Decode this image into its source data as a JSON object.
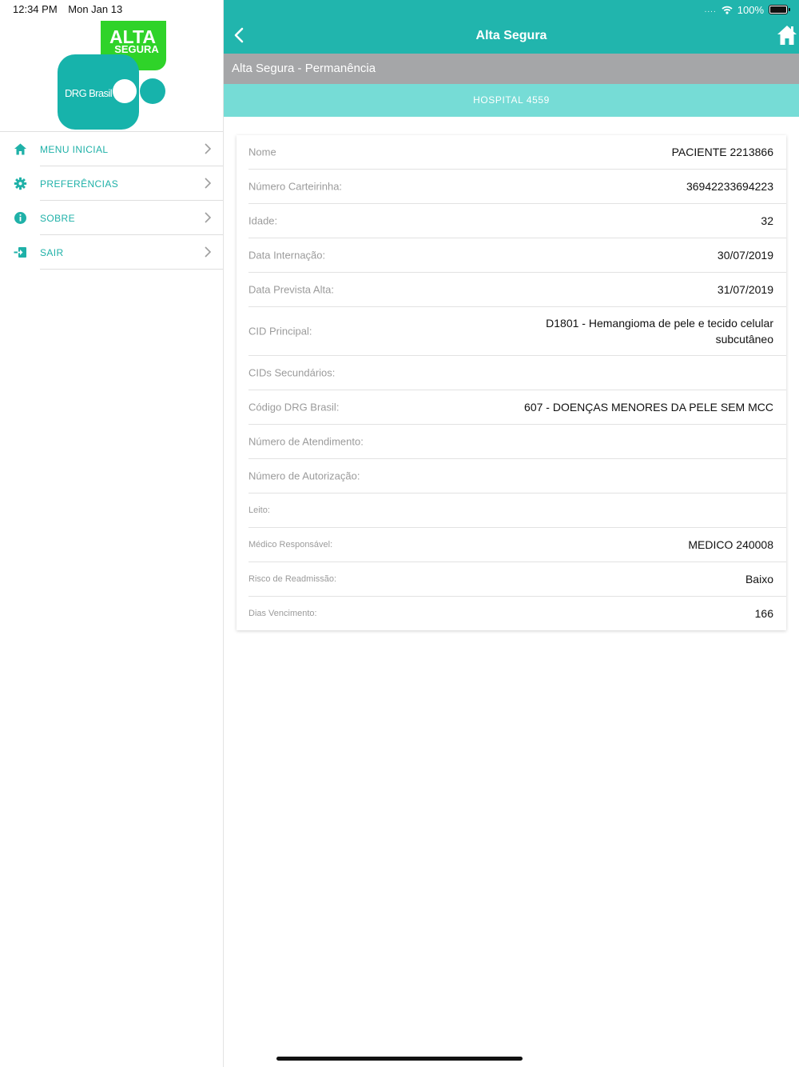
{
  "status": {
    "time": "12:34 PM",
    "date": "Mon Jan 13",
    "battery": "100%"
  },
  "logo": {
    "line1": "ALTA",
    "line2": "SEGURA",
    "brand": "DRG Brasil"
  },
  "menu": [
    {
      "label": "MENU INICIAL",
      "icon": "home-icon"
    },
    {
      "label": "PREFERÊNCIAS",
      "icon": "gear-icon"
    },
    {
      "label": "SOBRE",
      "icon": "info-icon"
    },
    {
      "label": "SAIR",
      "icon": "exit-icon"
    }
  ],
  "nav": {
    "title": "Alta Segura"
  },
  "subheader": "Alta Segura - Permanência",
  "hospital": "HOSPITAL 4559",
  "details": [
    {
      "label": "Nome",
      "value": "PACIENTE 2213866"
    },
    {
      "label": "Número Carteirinha:",
      "value": "36942233694223"
    },
    {
      "label": "Idade:",
      "value": "32"
    },
    {
      "label": "Data Internação:",
      "value": "30/07/2019"
    },
    {
      "label": "Data Prevista Alta:",
      "value": "31/07/2019"
    },
    {
      "label": "CID Principal:",
      "value": "D1801 - Hemangioma de pele e tecido celular subcutâneo"
    },
    {
      "label": "CIDs Secundários:",
      "value": ""
    },
    {
      "label": "Código DRG Brasil:",
      "value": "607 - DOENÇAS MENORES DA PELE SEM MCC"
    },
    {
      "label": "Número de Atendimento:",
      "value": ""
    },
    {
      "label": "Número de Autorização:",
      "value": ""
    },
    {
      "label": "Leito:",
      "value": ""
    },
    {
      "label": "Médico Responsável:",
      "value": "MEDICO 240008"
    },
    {
      "label": "Risco de Readmissão:",
      "value": "Baixo"
    },
    {
      "label": "Dias Vencimento:",
      "value": "166"
    }
  ],
  "colors": {
    "primary": "#21b5ad",
    "accent_light": "#76dcd6",
    "subheader": "#a5a6a8",
    "logo_green": "#2fd329"
  }
}
